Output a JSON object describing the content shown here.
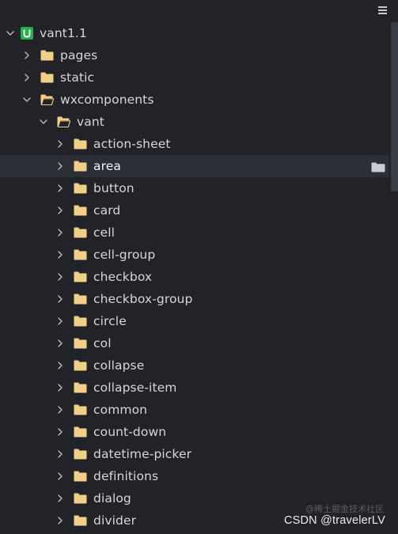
{
  "header": {
    "menu_icon": "hamburger-menu-icon"
  },
  "tree": {
    "project": {
      "label": "vant1.1",
      "icon": "uni-app-project-icon",
      "accent": "#22b14c",
      "expanded": true
    },
    "items": [
      {
        "label": "pages",
        "depth": 1,
        "expanded": false,
        "open_folder": false
      },
      {
        "label": "static",
        "depth": 1,
        "expanded": false,
        "open_folder": false
      },
      {
        "label": "wxcomponents",
        "depth": 1,
        "expanded": true,
        "open_folder": true
      },
      {
        "label": "vant",
        "depth": 2,
        "expanded": true,
        "open_folder": true
      },
      {
        "label": "action-sheet",
        "depth": 3,
        "expanded": false,
        "open_folder": false
      },
      {
        "label": "area",
        "depth": 3,
        "expanded": false,
        "open_folder": false,
        "selected": true
      },
      {
        "label": "button",
        "depth": 3,
        "expanded": false,
        "open_folder": false
      },
      {
        "label": "card",
        "depth": 3,
        "expanded": false,
        "open_folder": false
      },
      {
        "label": "cell",
        "depth": 3,
        "expanded": false,
        "open_folder": false
      },
      {
        "label": "cell-group",
        "depth": 3,
        "expanded": false,
        "open_folder": false
      },
      {
        "label": "checkbox",
        "depth": 3,
        "expanded": false,
        "open_folder": false
      },
      {
        "label": "checkbox-group",
        "depth": 3,
        "expanded": false,
        "open_folder": false
      },
      {
        "label": "circle",
        "depth": 3,
        "expanded": false,
        "open_folder": false
      },
      {
        "label": "col",
        "depth": 3,
        "expanded": false,
        "open_folder": false
      },
      {
        "label": "collapse",
        "depth": 3,
        "expanded": false,
        "open_folder": false
      },
      {
        "label": "collapse-item",
        "depth": 3,
        "expanded": false,
        "open_folder": false
      },
      {
        "label": "common",
        "depth": 3,
        "expanded": false,
        "open_folder": false
      },
      {
        "label": "count-down",
        "depth": 3,
        "expanded": false,
        "open_folder": false
      },
      {
        "label": "datetime-picker",
        "depth": 3,
        "expanded": false,
        "open_folder": false
      },
      {
        "label": "definitions",
        "depth": 3,
        "expanded": false,
        "open_folder": false
      },
      {
        "label": "dialog",
        "depth": 3,
        "expanded": false,
        "open_folder": false
      },
      {
        "label": "divider",
        "depth": 3,
        "expanded": false,
        "open_folder": false
      }
    ],
    "selected_row_action_icon": "reveal-in-folder-icon"
  },
  "colors": {
    "background": "#212328",
    "selected_row": "#2c2f36",
    "folder_fill": "#f1cf84",
    "chevron": "#b9bcc2",
    "text": "#d4d7dc"
  },
  "watermark": {
    "text": "CSDN @travelerLV",
    "faint_text": "@稀土掘金技术社区"
  }
}
